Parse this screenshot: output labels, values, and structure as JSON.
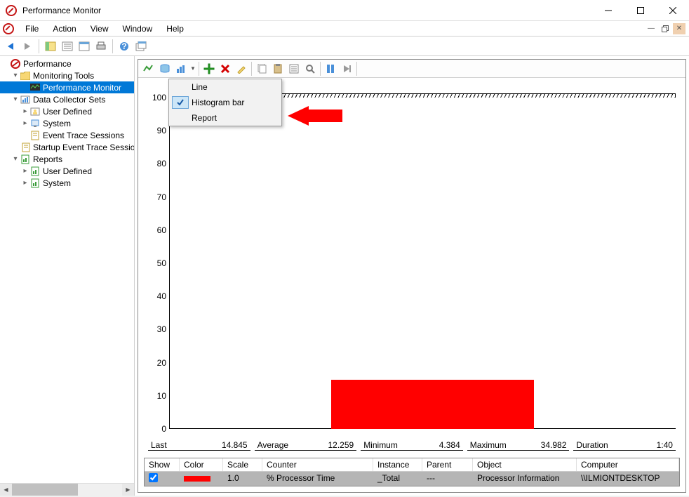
{
  "window": {
    "title": "Performance Monitor"
  },
  "menubar": {
    "items": [
      "File",
      "Action",
      "View",
      "Window",
      "Help"
    ]
  },
  "tree": {
    "root": "Performance",
    "monitoring_tools": "Monitoring Tools",
    "performance_monitor": "Performance Monitor",
    "data_collector_sets": "Data Collector Sets",
    "dcs_user_defined": "User Defined",
    "dcs_system": "System",
    "dcs_event_trace": "Event Trace Sessions",
    "dcs_startup_trace": "Startup Event Trace Sessions",
    "reports": "Reports",
    "rep_user_defined": "User Defined",
    "rep_system": "System"
  },
  "dropdown": {
    "items": [
      "Line",
      "Histogram bar",
      "Report"
    ],
    "selected_index": 1
  },
  "chart_data": {
    "type": "bar",
    "categories": [
      "% Processor Time"
    ],
    "values": [
      14.845
    ],
    "ylim": [
      0,
      100
    ],
    "y_ticks": [
      0,
      10,
      20,
      30,
      40,
      50,
      60,
      70,
      80,
      90,
      100
    ],
    "title": "",
    "xlabel": "",
    "ylabel": ""
  },
  "stats": {
    "last_label": "Last",
    "last_value": "14.845",
    "average_label": "Average",
    "average_value": "12.259",
    "minimum_label": "Minimum",
    "minimum_value": "4.384",
    "maximum_label": "Maximum",
    "maximum_value": "34.982",
    "duration_label": "Duration",
    "duration_value": "1:40"
  },
  "counters": {
    "headers": {
      "show": "Show",
      "color": "Color",
      "scale": "Scale",
      "counter": "Counter",
      "instance": "Instance",
      "parent": "Parent",
      "object": "Object",
      "computer": "Computer"
    },
    "rows": [
      {
        "show": true,
        "color": "#ff0000",
        "scale": "1.0",
        "counter": "% Processor Time",
        "instance": "_Total",
        "parent": "---",
        "object": "Processor Information",
        "computer": "\\\\ILMIONTDESKTOP"
      }
    ]
  },
  "icons": {
    "back": "back-arrow-icon",
    "forward": "forward-arrow-icon",
    "view_current": "view-current-icon",
    "show_pane": "show-pane-icon",
    "plus": "add-icon",
    "delete": "delete-icon",
    "highlight": "highlight-icon",
    "copy": "copy-icon",
    "paste": "paste-icon",
    "props": "properties-icon",
    "zoom": "zoom-icon",
    "freeze": "freeze-icon",
    "update": "update-icon"
  }
}
